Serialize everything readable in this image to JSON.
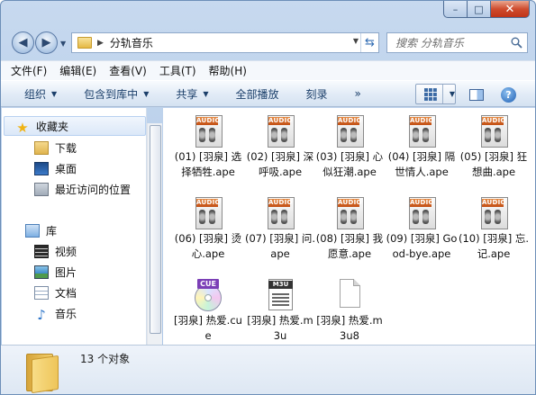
{
  "window": {
    "buttons": {
      "minimize": "–",
      "maximize": "□",
      "close": "✕"
    }
  },
  "address": {
    "path": "分轨音乐",
    "search_placeholder": "搜索 分轨音乐"
  },
  "menu": [
    "文件(F)",
    "编辑(E)",
    "查看(V)",
    "工具(T)",
    "帮助(H)"
  ],
  "toolbar": {
    "organize": "组织",
    "include_in_library": "包含到库中",
    "share": "共享",
    "play_all": "全部播放",
    "burn": "刻录",
    "more": "»"
  },
  "nav": {
    "favorites": "收藏夹",
    "downloads": "下载",
    "desktop": "桌面",
    "recent": "最近访问的位置",
    "libraries": "库",
    "videos": "视频",
    "pictures": "图片",
    "documents": "文档",
    "music": "音乐"
  },
  "files": [
    {
      "name": "(01) [羽泉] 选择牺牲.ape",
      "type": "audio"
    },
    {
      "name": "(02) [羽泉] 深呼吸.ape",
      "type": "audio"
    },
    {
      "name": "(03) [羽泉] 心似狂潮.ape",
      "type": "audio"
    },
    {
      "name": "(04) [羽泉] 隔世情人.ape",
      "type": "audio"
    },
    {
      "name": "(05) [羽泉] 狂想曲.ape",
      "type": "audio"
    },
    {
      "name": "(06) [羽泉] 烫心.ape",
      "type": "audio"
    },
    {
      "name": "(07) [羽泉] 问.ape",
      "type": "audio"
    },
    {
      "name": "(08) [羽泉] 我愿意.ape",
      "type": "audio"
    },
    {
      "name": "(09) [羽泉] Good-bye.ape",
      "type": "audio"
    },
    {
      "name": "(10) [羽泉] 忘.记.ape",
      "type": "audio"
    },
    {
      "name": "[羽泉] 热爱.cue",
      "type": "cue"
    },
    {
      "name": "[羽泉] 热爱.m3u",
      "type": "m3u"
    },
    {
      "name": "[羽泉] 热爱.m3u8",
      "type": "blank"
    }
  ],
  "icon_labels": {
    "audio": "AUDIO",
    "cue": "CUE",
    "m3u": "M3U"
  },
  "details": {
    "count": "13 个对象"
  }
}
